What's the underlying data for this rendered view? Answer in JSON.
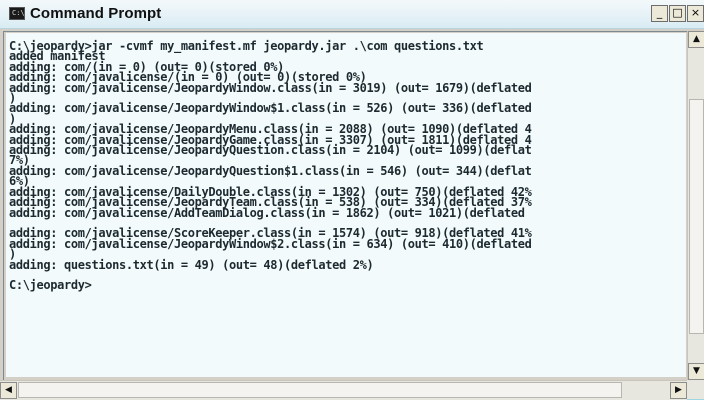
{
  "window": {
    "title": "Command Prompt",
    "controls": {
      "minimize": "_",
      "maximize": "□",
      "close": "×"
    }
  },
  "console": {
    "lines": [
      "C:\\jeopardy>jar -cvmf my_manifest.mf jeopardy.jar .\\com questions.txt",
      "added manifest",
      "adding: com/(in = 0) (out= 0)(stored 0%)",
      "adding: com/javalicense/(in = 0) (out= 0)(stored 0%)",
      "adding: com/javalicense/JeopardyWindow.class(in = 3019) (out= 1679)(deflated",
      ")",
      "adding: com/javalicense/JeopardyWindow$1.class(in = 526) (out= 336)(deflated",
      ")",
      "adding: com/javalicense/JeopardyMenu.class(in = 2088) (out= 1090)(deflated 4",
      "adding: com/javalicense/JeopardyGame.class(in = 3307) (out= 1811)(deflated 4",
      "adding: com/javalicense/JeopardyQuestion.class(in = 2104) (out= 1099)(deflat",
      "7%)",
      "adding: com/javalicense/JeopardyQuestion$1.class(in = 546) (out= 344)(deflat",
      "6%)",
      "adding: com/javalicense/DailyDouble.class(in = 1302) (out= 750)(deflated 42%",
      "adding: com/javalicense/JeopardyTeam.class(in = 538) (out= 334)(deflated 37%",
      "adding: com/javalicense/AddTeamDialog.class(in = 1862) (out= 1021)(deflated",
      "",
      "adding: com/javalicense/ScoreKeeper.class(in = 1574) (out= 918)(deflated 41%",
      "adding: com/javalicense/JeopardyWindow$2.class(in = 634) (out= 410)(deflated",
      ")",
      "adding: questions.txt(in = 49) (out= 48)(deflated 2%)",
      "",
      "C:\\jeopardy>"
    ]
  },
  "scrollbars": {
    "up_arrow": "▲",
    "down_arrow": "▼",
    "left_arrow": "◀",
    "right_arrow": "▶"
  }
}
